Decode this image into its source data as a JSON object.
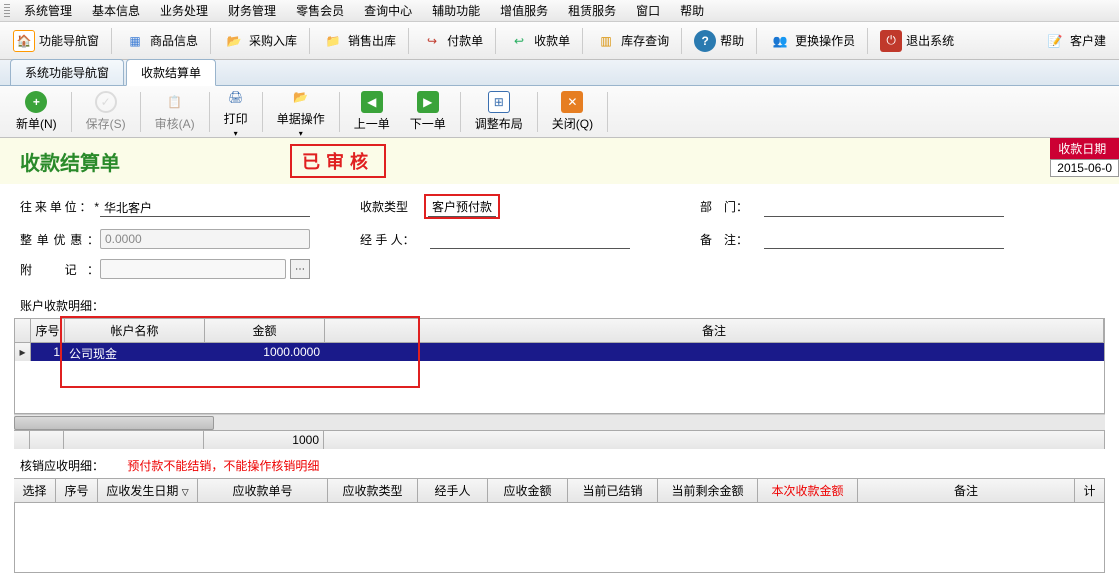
{
  "menubar": [
    "系统管理",
    "基本信息",
    "业务处理",
    "财务管理",
    "零售会员",
    "查询中心",
    "辅助功能",
    "增值服务",
    "租赁服务",
    "窗口",
    "帮助"
  ],
  "toolbar": [
    {
      "label": "功能导航窗",
      "icon": "home",
      "color": "#ff9900"
    },
    {
      "label": "商品信息",
      "icon": "grid",
      "color": "#3a7bd5"
    },
    {
      "label": "采购入库",
      "icon": "folder-in",
      "color": "#e6a000"
    },
    {
      "label": "销售出库",
      "icon": "folder-out",
      "color": "#e6a000"
    },
    {
      "label": "付款单",
      "icon": "pay",
      "color": "#c0392b"
    },
    {
      "label": "收款单",
      "icon": "recv",
      "color": "#27ae60"
    },
    {
      "label": "库存查询",
      "icon": "boxes",
      "color": "#d98f00"
    },
    {
      "label": "帮助",
      "icon": "help",
      "color": "#2a7ab0"
    },
    {
      "label": "更换操作员",
      "icon": "users",
      "color": "#8e7cc3"
    },
    {
      "label": "退出系统",
      "icon": "power",
      "color": "#c0392b"
    }
  ],
  "right_toolbar": {
    "label": "客户建"
  },
  "tabs": [
    {
      "label": "系统功能导航窗",
      "active": false
    },
    {
      "label": "收款结算单",
      "active": true
    }
  ],
  "ribbon": [
    {
      "label": "新单(N)",
      "icon": "plus",
      "color": "#3aa33a",
      "disabled": false
    },
    {
      "label": "保存(S)",
      "icon": "check",
      "color": "#999",
      "disabled": true
    },
    {
      "label": "审核(A)",
      "icon": "stamp",
      "color": "#999",
      "disabled": true
    },
    {
      "label": "打印",
      "icon": "print",
      "color": "#3a6fb0",
      "disabled": false
    },
    {
      "label": "单据操作",
      "icon": "doc-ops",
      "color": "#e6a000",
      "disabled": false
    },
    {
      "label": "上一单",
      "icon": "prev",
      "color": "#3aa33a",
      "disabled": false
    },
    {
      "label": "下一单",
      "icon": "next",
      "color": "#3aa33a",
      "disabled": false
    },
    {
      "label": "调整布局",
      "icon": "layout",
      "color": "#3a6fb0",
      "disabled": false
    },
    {
      "label": "关闭(Q)",
      "icon": "close",
      "color": "#e67e22",
      "disabled": false
    }
  ],
  "doc": {
    "title": "收款结算单",
    "stamp": "已审核",
    "date_label": "收款日期",
    "date_value": "2015-06-0"
  },
  "form": {
    "unit_label": "往来单位：*",
    "unit_value": "华北客户",
    "type_label": "收款类型",
    "type_value": "客户预付款",
    "dept_label": "部　门：",
    "dept_value": "",
    "discount_label": "整单优惠：",
    "discount_value": "0.0000",
    "handler_label": "经 手 人：",
    "handler_value": "",
    "remark_label": "备　注：",
    "remark_value": "",
    "attach_label": "附　记：",
    "attach_value": ""
  },
  "grid1": {
    "section": "账户收款明细：",
    "cols": [
      "序号",
      "帐户名称",
      "金额",
      "备注"
    ],
    "row": {
      "seq": "1",
      "acct": "公司现金",
      "amount": "1000.0000",
      "remark": ""
    },
    "footer_amount": "1000"
  },
  "writeoff": {
    "label": "核销应收明细：",
    "note": "预付款不能结销，不能操作核销明细"
  },
  "grid2_cols": [
    "选择",
    "序号",
    "应收发生日期",
    "应收款单号",
    "应收款类型",
    "经手人",
    "应收金额",
    "当前已结销",
    "当前剩余金额",
    "本次收款金额",
    "备注",
    "计"
  ]
}
